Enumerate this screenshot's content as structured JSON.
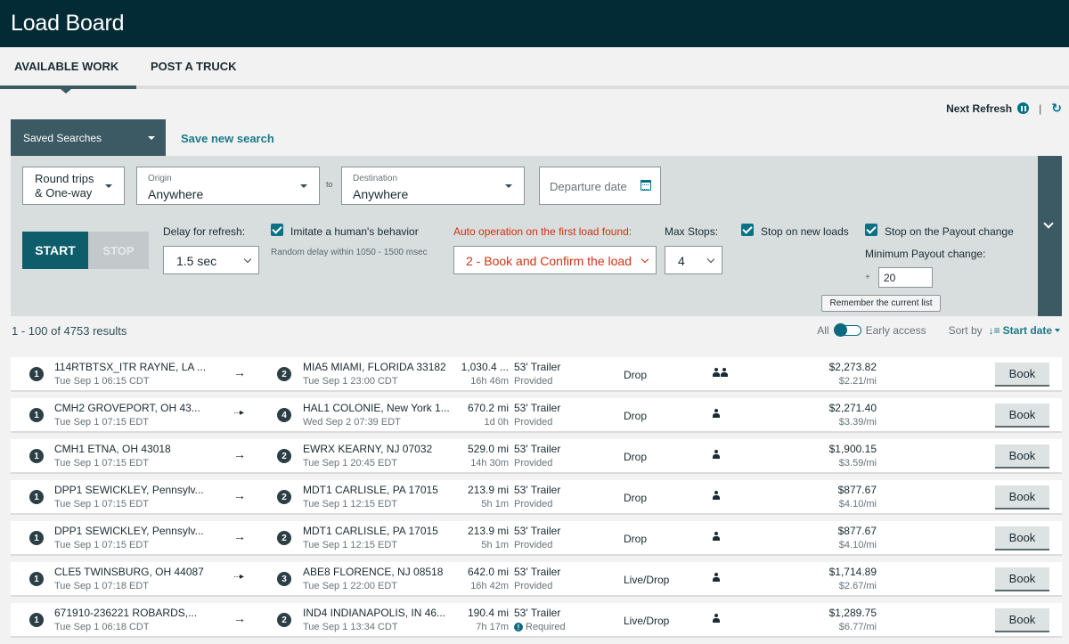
{
  "app": {
    "title": "Load Board"
  },
  "tabs": [
    {
      "label": "AVAILABLE WORK",
      "active": true
    },
    {
      "label": "POST A TRUCK",
      "active": false
    }
  ],
  "refresh": {
    "label": "Next Refresh",
    "pause_icon": "pause-circle-icon",
    "separator": "|",
    "refresh_icon": "sync-icon"
  },
  "saved_searches": {
    "label": "Saved Searches",
    "save_new": "Save new search"
  },
  "search": {
    "trip_type": {
      "line1": "Round trips",
      "line2": "& One-way"
    },
    "origin": {
      "label": "Origin",
      "value": "Anywhere"
    },
    "to_label": "to",
    "destination": {
      "label": "Destination",
      "value": "Anywhere"
    },
    "departure": {
      "placeholder": "Departure date"
    }
  },
  "controls": {
    "start": "START",
    "stop": "STOP",
    "delay_label": "Delay for refresh:",
    "delay_value": "1.5 sec",
    "imitate_label": "Imitate a human's behavior",
    "imitate_checked": true,
    "random_delay_note": "Random delay within 1050 - 1500 msec",
    "auto_op_label": "Auto operation on the first load found:",
    "auto_op_value": "2 - Book and Confirm the load",
    "max_stops_label": "Max Stops:",
    "max_stops_value": "4",
    "stop_new_loads_label": "Stop on new loads",
    "stop_new_loads_checked": true,
    "stop_payout_label": "Stop on the Payout change",
    "stop_payout_checked": true,
    "min_payout_label": "Minimum Payout change:",
    "min_payout_prefix": "+",
    "min_payout_value": "20",
    "remember_label": "Remember the current list"
  },
  "results": {
    "summary": "1 - 100 of 4753 results",
    "filter_all": "All",
    "filter_early": "Early access",
    "sort_label": "Sort by",
    "sort_value": "Start date"
  },
  "loads": [
    {
      "origin_stop": "1",
      "origin": "114RTBTSX_ITR RAYNE, LA ...",
      "origin_time": "Tue Sep 1 06:15 CDT",
      "arrow": "solid",
      "dest_stop": "2",
      "dest": "MIA5 MIAMI, FLORIDA 33182",
      "dest_time": "Tue Sep 1 23:00 CDT",
      "distance": "1,030.4 ...",
      "duration": "16h 46m",
      "equipment": "53' Trailer",
      "trailer_status": "Provided",
      "trailer_required": false,
      "load_type": "Drop",
      "driver": "team",
      "price": "$2,273.82",
      "rate": "$2.21/mi",
      "book": "Book"
    },
    {
      "origin_stop": "1",
      "origin": "CMH2 GROVEPORT, OH 43...",
      "origin_time": "Tue Sep 1 07:15 EDT",
      "arrow": "dotted",
      "dest_stop": "4",
      "dest": "HAL1 COLONIE, New York 1...",
      "dest_time": "Wed Sep 2 07:39 EDT",
      "distance": "670.2 mi",
      "duration": "1d 0h",
      "equipment": "53' Trailer",
      "trailer_status": "Provided",
      "trailer_required": false,
      "load_type": "Drop",
      "driver": "solo",
      "price": "$2,271.40",
      "rate": "$3.39/mi",
      "book": "Book"
    },
    {
      "origin_stop": "1",
      "origin": "CMH1 ETNA, OH 43018",
      "origin_time": "Tue Sep 1 07:15 EDT",
      "arrow": "solid",
      "dest_stop": "2",
      "dest": "EWRX KEARNY, NJ 07032",
      "dest_time": "Tue Sep 1 20:45 EDT",
      "distance": "529.0 mi",
      "duration": "14h 30m",
      "equipment": "53' Trailer",
      "trailer_status": "Provided",
      "trailer_required": false,
      "load_type": "Drop",
      "driver": "solo",
      "price": "$1,900.15",
      "rate": "$3.59/mi",
      "book": "Book"
    },
    {
      "origin_stop": "1",
      "origin": "DPP1 SEWICKLEY, Pennsylv...",
      "origin_time": "Tue Sep 1 07:15 EDT",
      "arrow": "solid",
      "dest_stop": "2",
      "dest": "MDT1 CARLISLE, PA 17015",
      "dest_time": "Tue Sep 1 12:15 EDT",
      "distance": "213.9 mi",
      "duration": "5h 1m",
      "equipment": "53' Trailer",
      "trailer_status": "Provided",
      "trailer_required": false,
      "load_type": "Drop",
      "driver": "solo",
      "price": "$877.67",
      "rate": "$4.10/mi",
      "book": "Book"
    },
    {
      "origin_stop": "1",
      "origin": "DPP1 SEWICKLEY, Pennsylv...",
      "origin_time": "Tue Sep 1 07:15 EDT",
      "arrow": "solid",
      "dest_stop": "2",
      "dest": "MDT1 CARLISLE, PA 17015",
      "dest_time": "Tue Sep 1 12:15 EDT",
      "distance": "213.9 mi",
      "duration": "5h 1m",
      "equipment": "53' Trailer",
      "trailer_status": "Provided",
      "trailer_required": false,
      "load_type": "Drop",
      "driver": "solo",
      "price": "$877.67",
      "rate": "$4.10/mi",
      "book": "Book"
    },
    {
      "origin_stop": "1",
      "origin": "CLE5 TWINSBURG, OH 44087",
      "origin_time": "Tue Sep 1 07:18 EDT",
      "arrow": "dotted",
      "dest_stop": "3",
      "dest": "ABE8 FLORENCE, NJ 08518",
      "dest_time": "Tue Sep 1 22:00 EDT",
      "distance": "642.0 mi",
      "duration": "16h 42m",
      "equipment": "53' Trailer",
      "trailer_status": "Provided",
      "trailer_required": false,
      "load_type": "Live/Drop",
      "driver": "solo",
      "price": "$1,714.89",
      "rate": "$2.67/mi",
      "book": "Book"
    },
    {
      "origin_stop": "1",
      "origin": "671910-236221 ROBARDS,...",
      "origin_time": "Tue Sep 1 06:18 CDT",
      "arrow": "solid",
      "dest_stop": "2",
      "dest": "IND4 INDIANAPOLIS, IN 46...",
      "dest_time": "Tue Sep 1 13:34 CDT",
      "distance": "190.4 mi",
      "duration": "7h 17m",
      "equipment": "53' Trailer",
      "trailer_status": "Required",
      "trailer_required": true,
      "load_type": "Live/Drop",
      "driver": "solo",
      "price": "$1,289.75",
      "rate": "$6.77/mi",
      "book": "Book"
    }
  ]
}
